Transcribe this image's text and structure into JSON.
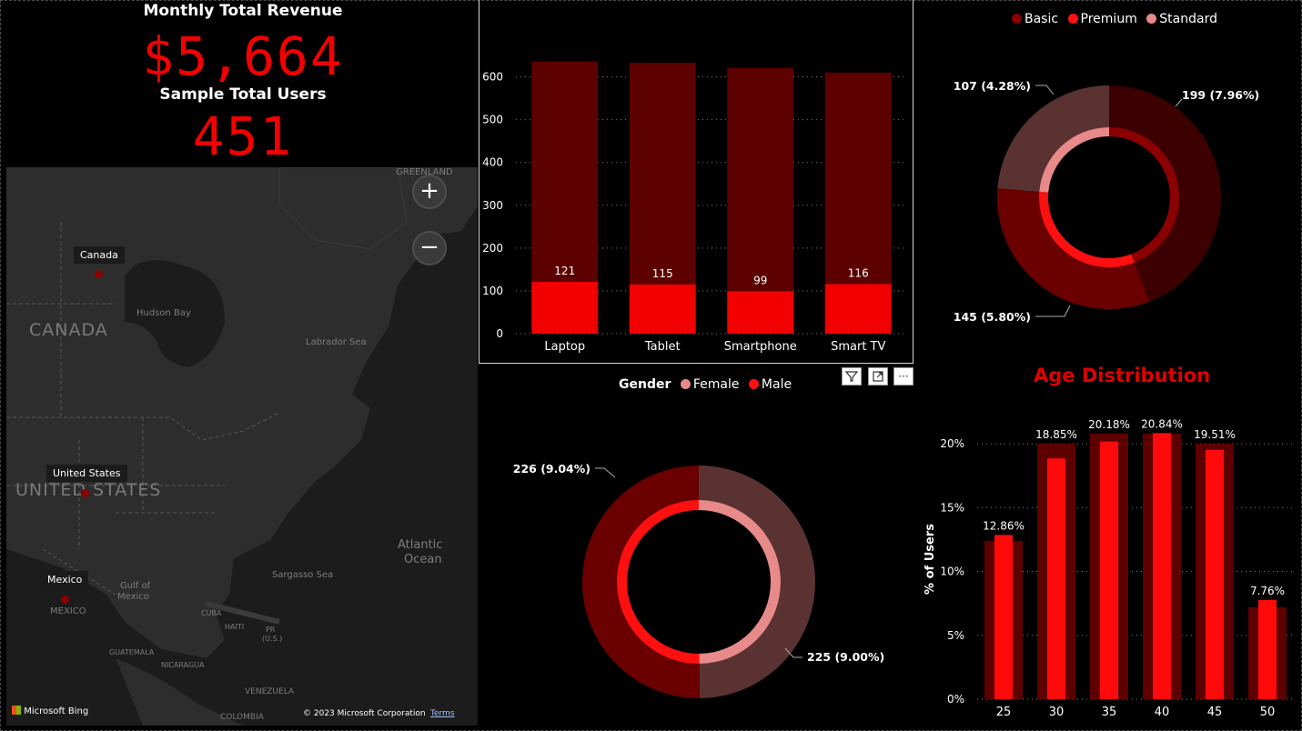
{
  "kpis": {
    "revenue_title": "Monthly Total Revenue",
    "revenue_value": "$5,664",
    "users_title": "Sample Total Users",
    "users_value": "451"
  },
  "map": {
    "labels": [
      "Canada",
      "United States",
      "Mexico"
    ],
    "region_names": {
      "greenland": "GREENLAND",
      "canada_big": "CANADA",
      "us_big": "UNITED STATES",
      "mexico_small": "MEXICO",
      "hudson_bay": "Hudson Bay",
      "labrador_sea": "Labrador Sea",
      "atlantic": "Atlantic",
      "ocean": "Ocean",
      "sargasso": "Sargasso Sea",
      "gulf1": "Gulf of",
      "gulf2": "Mexico",
      "cuba": "CUBA",
      "haiti": "HAITI",
      "pr": "PR",
      "us_small": "(U.S.)",
      "guatemala": "GUATEMALA",
      "nicaragua": "NICARAGUA",
      "venezuela": "VENEZUELA",
      "colombia": "COLOMBIA"
    },
    "zoom_in": "+",
    "zoom_out": "−",
    "bing": "Microsoft Bing",
    "copyright": "© 2023 Microsoft Corporation",
    "terms": "Terms",
    "colors": {
      "marker": "#8a0000",
      "land": "#2d2d2d"
    }
  },
  "device_chart": {
    "chart_data": {
      "type": "bar",
      "categories": [
        "Laptop",
        "Tablet",
        "Smartphone",
        "Smart TV"
      ],
      "series": [
        {
          "values": [
            121,
            115,
            99,
            116
          ],
          "color": "#f20000",
          "labels": [
            "121",
            "115",
            "99",
            "116"
          ]
        },
        {
          "values": [
            636,
            633,
            621,
            610
          ],
          "color": "#5c0000"
        }
      ],
      "ylim": [
        0,
        650
      ],
      "yticks": [
        "0",
        "100",
        "200",
        "300",
        "400",
        "500",
        "600"
      ],
      "grid": true
    }
  },
  "toolbar": {
    "filter": "filter-icon",
    "focus": "focus-mode-icon",
    "more": "···"
  },
  "subscription_donut": {
    "legend": [
      {
        "label": "Basic",
        "color": "#8b0000"
      },
      {
        "label": "Premium",
        "color": "#ff1010"
      },
      {
        "label": "Standard",
        "color": "#e88a8a"
      }
    ],
    "chart_data": {
      "type": "pie",
      "outer": [
        {
          "value": 199,
          "label": "199 (7.96%)",
          "color": "#3d0000"
        },
        {
          "value": 145,
          "label": "145 (5.80%)",
          "color": "#6a0000"
        },
        {
          "value": 107,
          "label": "107 (4.28%)",
          "color": "#5a3232"
        }
      ],
      "inner": [
        {
          "value": 199,
          "color": "#8b0000"
        },
        {
          "value": 145,
          "color": "#ff1010"
        },
        {
          "value": 107,
          "color": "#e88a8a"
        }
      ]
    }
  },
  "gender_donut": {
    "legend_title": "Gender",
    "legend": [
      {
        "label": "Female",
        "color": "#e88a8a"
      },
      {
        "label": "Male",
        "color": "#ff1010"
      }
    ],
    "chart_data": {
      "type": "pie",
      "outer": [
        {
          "value": 225,
          "label": "225 (9.00%)",
          "color": "#5a3232"
        },
        {
          "value": 226,
          "label": "226 (9.04%)",
          "color": "#6a0000"
        }
      ],
      "inner": [
        {
          "value": 225,
          "color": "#e88a8a"
        },
        {
          "value": 226,
          "color": "#ff1010"
        }
      ]
    }
  },
  "age_chart": {
    "title": "Age Distribution",
    "chart_data": {
      "type": "bar",
      "categories": [
        "25",
        "30",
        "35",
        "40",
        "45",
        "50"
      ],
      "values": [
        12.86,
        18.85,
        20.18,
        20.84,
        19.51,
        7.76
      ],
      "labels": [
        "12.86%",
        "18.85%",
        "20.18%",
        "20.84%",
        "19.51%",
        "7.76%"
      ],
      "background_values": [
        12.4,
        20.0,
        20.8,
        20.8,
        20.0,
        7.2
      ],
      "ylabel": "% of Users",
      "ylim": [
        0,
        21.5
      ],
      "yticks": [
        0,
        5,
        10,
        15,
        20
      ],
      "ytick_labels": [
        "0%",
        "5%",
        "10%",
        "15%",
        "20%"
      ],
      "grid": true,
      "colors": {
        "fg": "#ff0a0a",
        "bg": "#5c0000"
      }
    }
  }
}
